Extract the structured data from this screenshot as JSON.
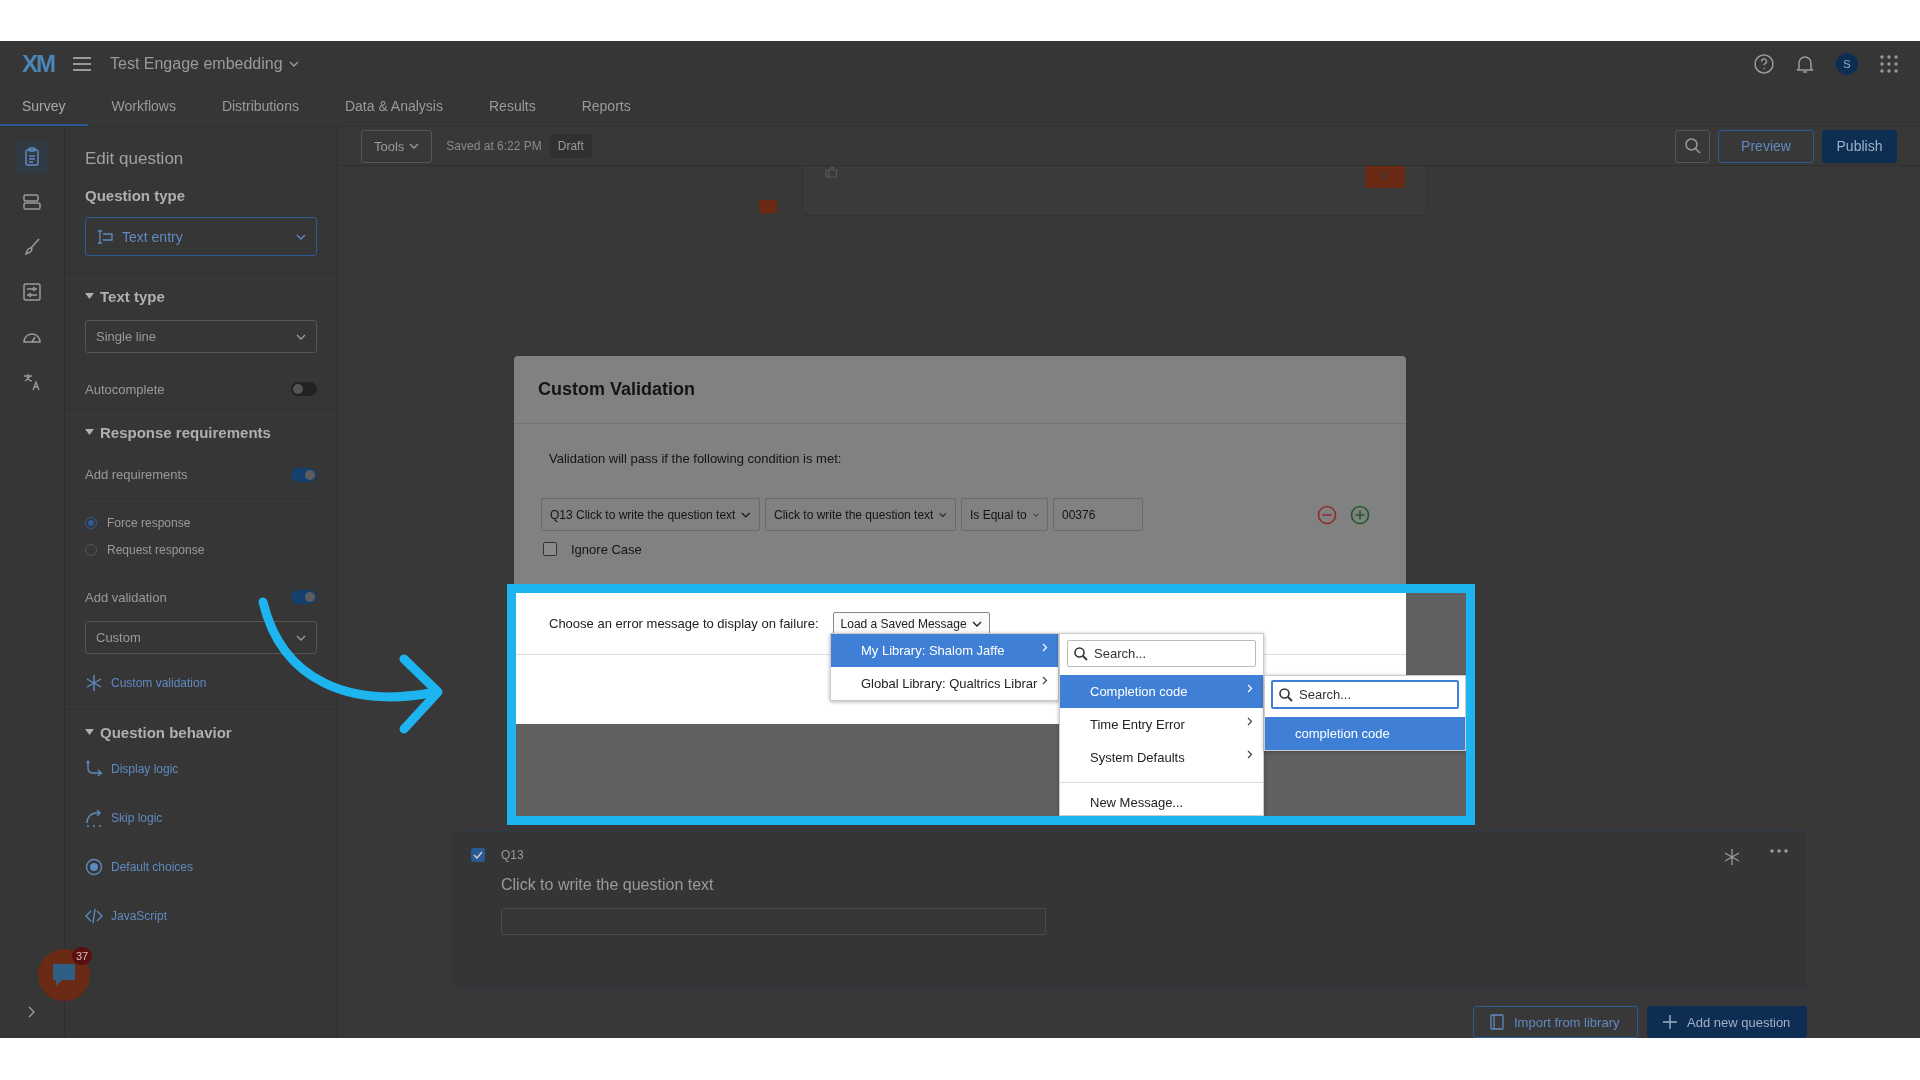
{
  "header": {
    "logo": "XM",
    "project": "Test Engage embedding",
    "avatar": "S"
  },
  "tabs": [
    {
      "label": "Survey",
      "selected": true
    },
    {
      "label": "Workflows",
      "selected": false
    },
    {
      "label": "Distributions",
      "selected": false
    },
    {
      "label": "Data & Analysis",
      "selected": false
    },
    {
      "label": "Results",
      "selected": false
    },
    {
      "label": "Reports",
      "selected": false
    }
  ],
  "rail": [
    {
      "selected": true
    },
    {
      "selected": false
    },
    {
      "selected": false
    },
    {
      "selected": false
    },
    {
      "selected": false
    },
    {
      "selected": false
    }
  ],
  "sidebar": {
    "title": "Edit question",
    "sections": [
      {
        "heading": "Question type",
        "collapsible": false,
        "items": [
          {
            "kind": "select",
            "value": "Text entry",
            "focused": true
          }
        ]
      },
      {
        "heading": "Text type",
        "collapsible": true,
        "items": [
          {
            "kind": "select",
            "value": "Single line",
            "focused": false
          },
          {
            "kind": "toggle",
            "label": "Autocomplete",
            "on": false
          }
        ]
      },
      {
        "heading": "Response requirements",
        "collapsible": true,
        "items": [
          {
            "kind": "toggle",
            "label": "Add requirements",
            "on": true
          },
          {
            "kind": "radio",
            "label": "Force response",
            "selected": true
          },
          {
            "kind": "radio",
            "label": "Request response",
            "selected": false
          },
          {
            "kind": "toggle",
            "label": "Add validation",
            "on": true
          },
          {
            "kind": "select",
            "value": "Custom",
            "focused": false
          },
          {
            "kind": "link",
            "label": "Custom validation"
          }
        ]
      },
      {
        "heading": "Question behavior",
        "collapsible": true,
        "items": [
          {
            "kind": "link",
            "label": "Display logic"
          },
          {
            "kind": "link",
            "label": "Skip logic"
          },
          {
            "kind": "link",
            "label": "Default choices"
          },
          {
            "kind": "link",
            "label": "JavaScript"
          }
        ]
      }
    ]
  },
  "chat_badge": "37",
  "toolbar": {
    "tools": "Tools",
    "saved": "Saved at 6:22 PM",
    "status": "Draft",
    "preview": "Preview",
    "publish": "Publish"
  },
  "modal": {
    "title": "Custom Validation",
    "intro": "Validation will pass if the following condition is met:",
    "condition": {
      "question": "Q13 Click to write the question text",
      "field": "Click to write the question text",
      "operator": "Is Equal to",
      "value": "00376"
    },
    "ignore_case": {
      "label": "Ignore Case",
      "checked": false
    },
    "error_label": "Choose an error message to display on failure:",
    "error_select": "Load a Saved Message"
  },
  "menus": [
    {
      "items": [
        {
          "label": "My Library: Shalom Jaffe",
          "selected": true,
          "submenu": true
        },
        {
          "label": "Global Library: Qualtrics Librar",
          "selected": false,
          "submenu": true
        }
      ]
    },
    {
      "search": {
        "placeholder": "Search...",
        "focused": false
      },
      "items": [
        {
          "label": "Completion code",
          "selected": true,
          "submenu": true
        },
        {
          "label": "Time Entry Error",
          "selected": false,
          "submenu": true
        },
        {
          "label": "System Defaults",
          "selected": false,
          "submenu": true
        },
        {
          "label": "New Message...",
          "selected": false,
          "submenu": false
        }
      ]
    },
    {
      "search": {
        "placeholder": "Search...",
        "focused": true
      },
      "items": [
        {
          "label": "completion code",
          "selected": true,
          "submenu": false
        }
      ]
    }
  ],
  "question": {
    "number": "Q13",
    "checked": true,
    "text": "Click to write the question text"
  },
  "footer_buttons": [
    "Import from library",
    "Add new question"
  ]
}
